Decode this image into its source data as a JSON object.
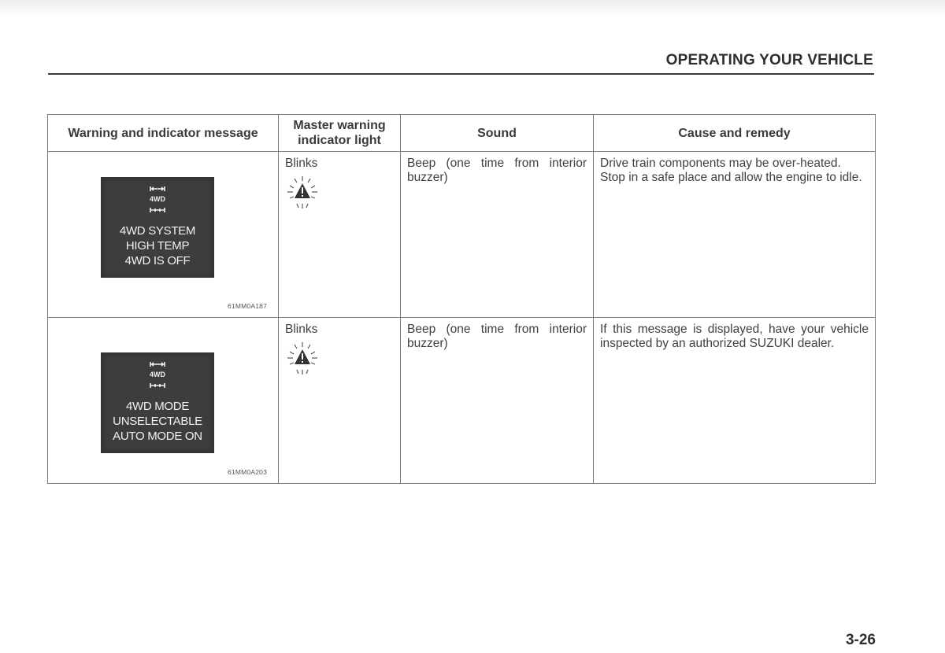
{
  "header": {
    "section_title": "OPERATING YOUR VEHICLE"
  },
  "table": {
    "columns": [
      "Warning and indicator message",
      "Master warning indicator light",
      "Sound",
      "Cause and remedy"
    ],
    "rows": [
      {
        "display": {
          "icon": "4wd-drivetrain-icon",
          "icon_label": "4WD",
          "lines": [
            "4WD SYSTEM",
            "HIGH TEMP",
            "4WD IS OFF"
          ],
          "image_code": "61MM0A187"
        },
        "master_light": {
          "text": "Blinks",
          "icon": "master-warning-triangle-icon"
        },
        "sound": "Beep (one time from interior buzzer)",
        "cause": [
          "Drive train components may be over-heated.",
          "Stop in a safe place and allow the engine to idle."
        ]
      },
      {
        "display": {
          "icon": "4wd-drivetrain-icon",
          "icon_label": "4WD",
          "lines": [
            "4WD MODE",
            "UNSELECTABLE",
            "AUTO MODE ON"
          ],
          "image_code": "61MM0A203"
        },
        "master_light": {
          "text": "Blinks",
          "icon": "master-warning-triangle-icon"
        },
        "sound": "Beep (one time from interior buzzer)",
        "cause": [
          "If this message is displayed, have your vehicle inspected by an authorized SUZUKI dealer."
        ]
      }
    ]
  },
  "footer": {
    "page_number": "3-26"
  }
}
